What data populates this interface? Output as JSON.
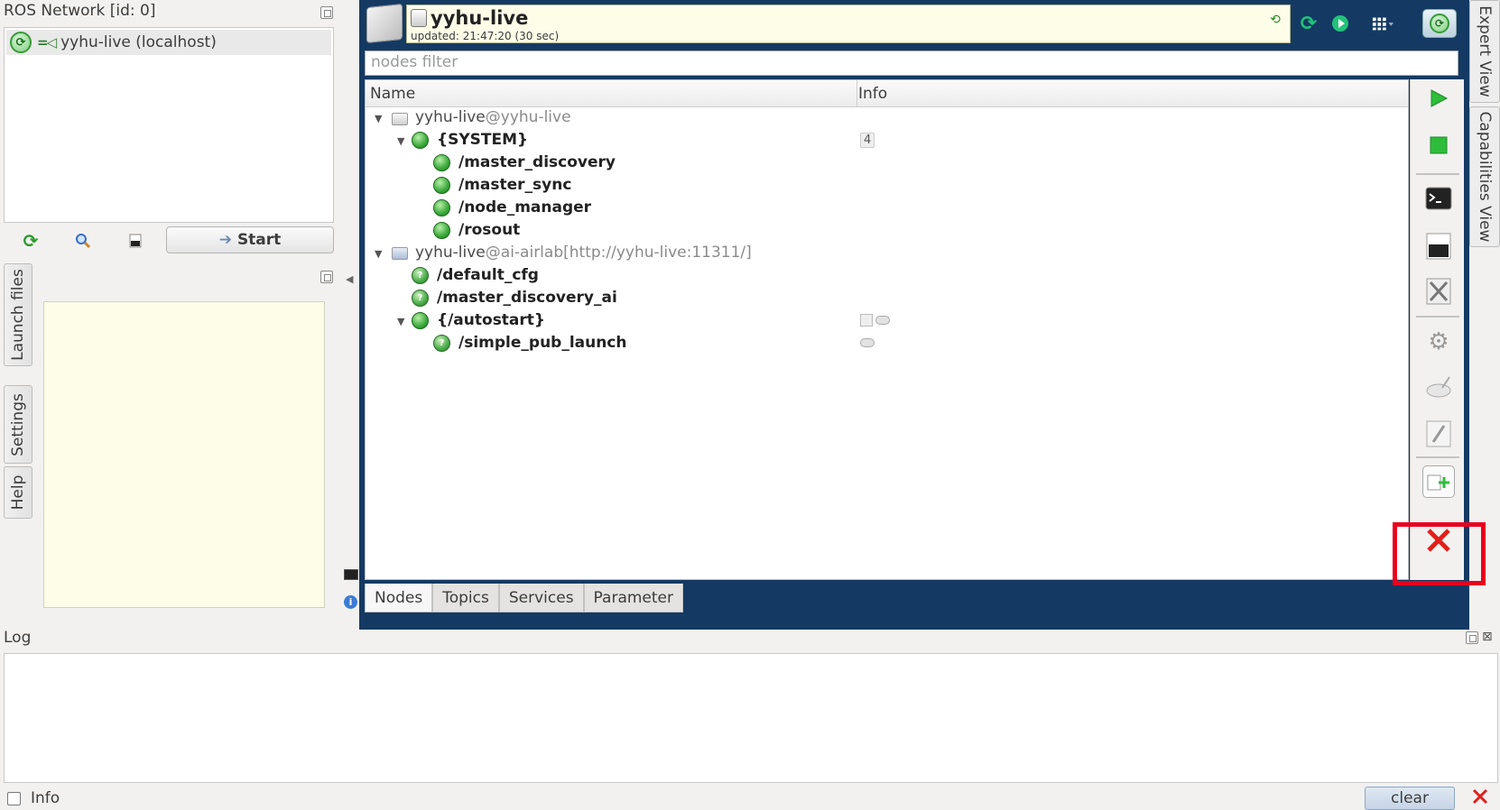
{
  "left_panel": {
    "title": "ROS Network [id: 0]",
    "master_item": "yyhu-live (localhost)",
    "start_label": "Start",
    "vtabs": [
      "Launch files",
      "Settings",
      "Help"
    ]
  },
  "master_view": {
    "host_title": "yyhu-live",
    "updated_text": "updated: 21:47:20 (30 sec)",
    "filter_placeholder": "nodes filter",
    "columns": [
      "Name",
      "Info"
    ],
    "tree": [
      {
        "label": "yyhu-live",
        "muted": "@yyhu-live"
      },
      {
        "label": "{SYSTEM}",
        "info": "4"
      },
      {
        "label": "/master_discovery"
      },
      {
        "label": "/master_sync"
      },
      {
        "label": "/node_manager"
      },
      {
        "label": "/rosout"
      },
      {
        "label": "yyhu-live",
        "muted": "@ai-airlab[http://yyhu-live:11311/]"
      },
      {
        "label": "/default_cfg"
      },
      {
        "label": "/master_discovery_ai"
      },
      {
        "label": "{/autostart}"
      },
      {
        "label": "/simple_pub_launch"
      }
    ],
    "tabs": [
      "Nodes",
      "Topics",
      "Services",
      "Parameter"
    ],
    "active_tab": "Nodes"
  },
  "right_tabs": [
    "Expert View",
    "Capabilities View"
  ],
  "log": {
    "title": "Log",
    "checkbox_label": "Info",
    "clear_label": "clear"
  },
  "colors": {
    "panel_blue": "#143a63",
    "node_green": "#3aa83a",
    "highlight_red": "#e8001d"
  }
}
